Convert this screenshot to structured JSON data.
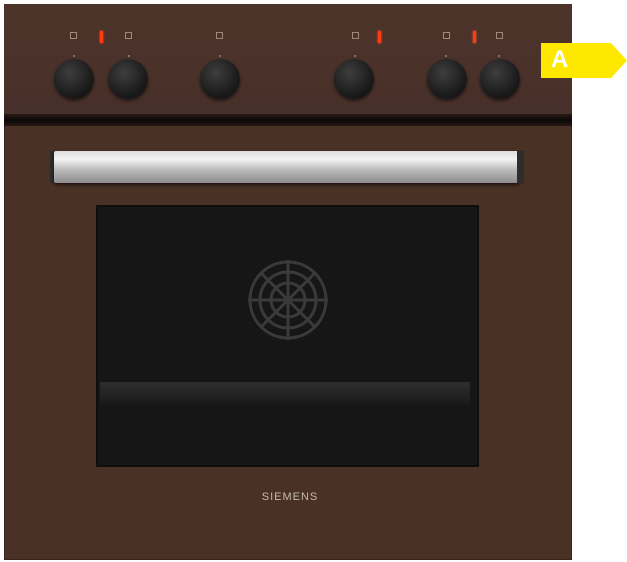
{
  "brand": "SIEMENS",
  "energy_label": {
    "grade": "A",
    "color": "#ffe800"
  },
  "colors": {
    "body": "#4a3126",
    "indicator": "#ff3b14",
    "knob": "#1c1c1c"
  },
  "controls": [
    {
      "name": "knob-1",
      "icon": "hob-zone-icon"
    },
    {
      "name": "knob-2",
      "icon": "hob-zone-icon"
    },
    {
      "name": "knob-3",
      "icon": "oven-mode-icon"
    },
    {
      "name": "knob-4",
      "icon": "hob-zone-icon"
    },
    {
      "name": "knob-5",
      "icon": "hob-zone-icon"
    },
    {
      "name": "knob-6",
      "icon": "hob-zone-icon"
    }
  ]
}
